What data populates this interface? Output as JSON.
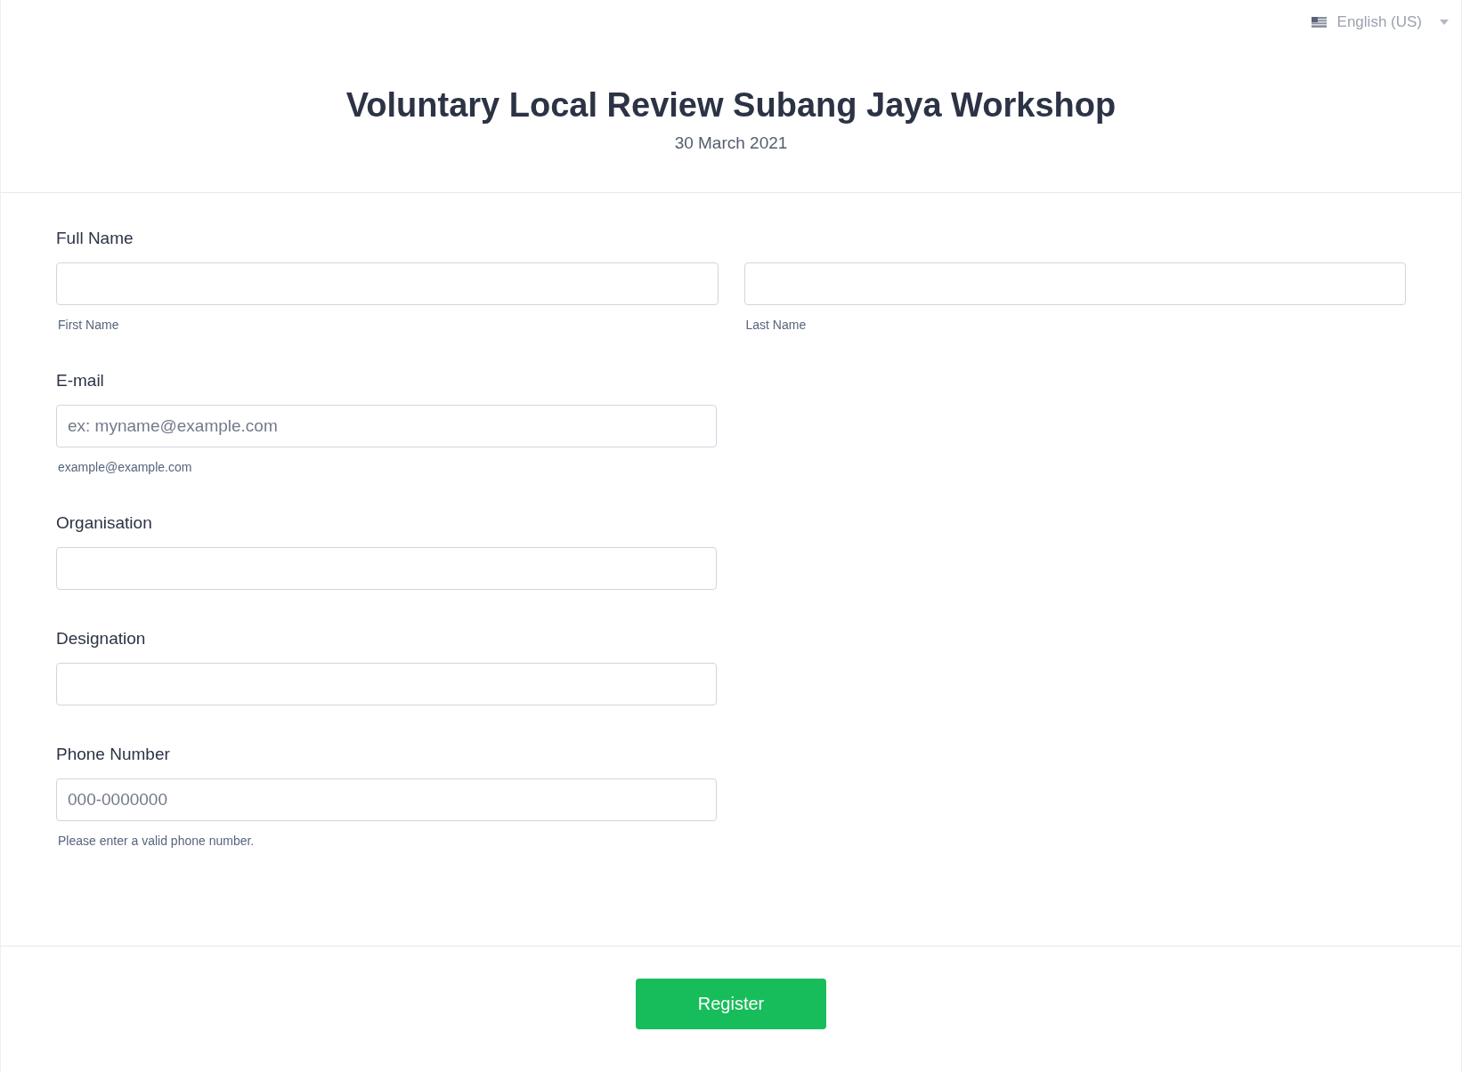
{
  "language": {
    "label": "English (US)"
  },
  "header": {
    "title": "Voluntary Local Review Subang Jaya Workshop",
    "date": "30 March 2021"
  },
  "fields": [
    {
      "kind": "pair",
      "label": "Full Name",
      "inputs": [
        {
          "sublabel": "First Name"
        },
        {
          "sublabel": "Last Name"
        }
      ]
    },
    {
      "kind": "single",
      "label": "E-mail",
      "placeholder": "ex: myname@example.com",
      "sublabel": "example@example.com"
    },
    {
      "kind": "single",
      "label": "Organisation"
    },
    {
      "kind": "single",
      "label": "Designation"
    },
    {
      "kind": "single",
      "label": "Phone Number",
      "placeholder": "000-0000000",
      "sublabel": "Please enter a valid phone number."
    }
  ],
  "submit": {
    "label": "Register"
  }
}
